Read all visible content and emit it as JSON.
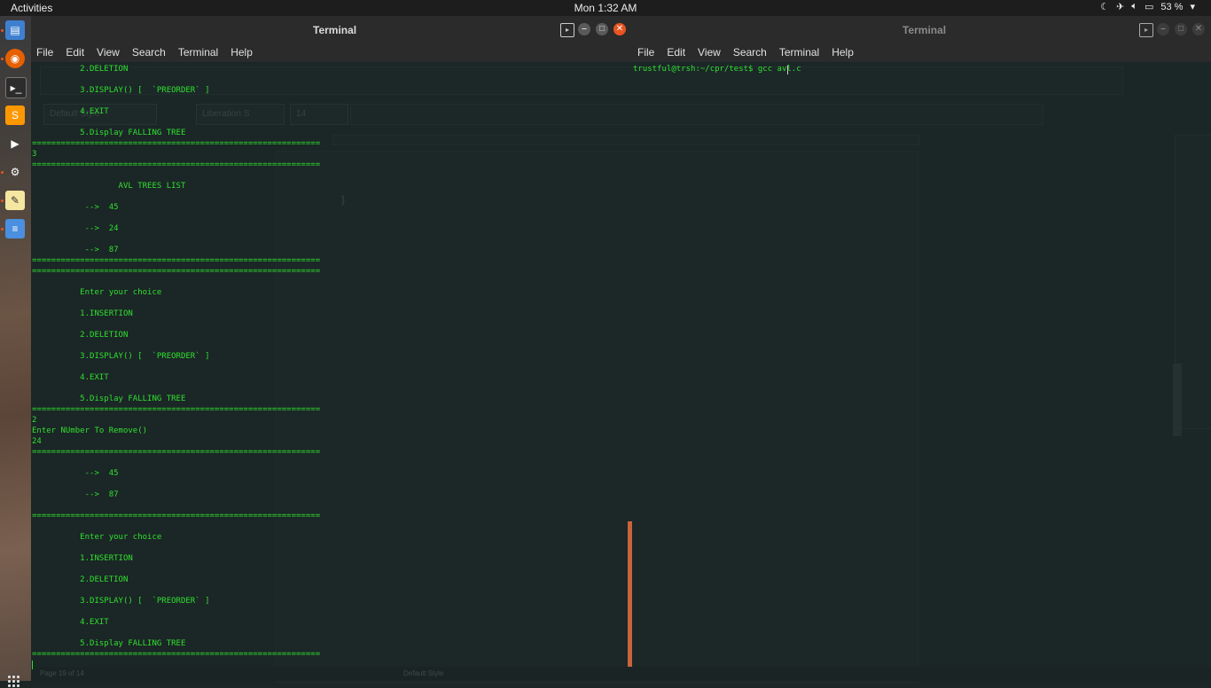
{
  "topbar": {
    "activities": "Activities",
    "clock": "Mon 1:32 AM",
    "battery": "53 %"
  },
  "dock": {
    "items": [
      "files-icon",
      "firefox-icon",
      "terminal-icon",
      "sublime-icon",
      "media-player-icon",
      "settings-icon",
      "text-editor-icon",
      "document-viewer-icon"
    ]
  },
  "left_window": {
    "title": "Terminal",
    "menu": [
      "File",
      "Edit",
      "View",
      "Search",
      "Terminal",
      "Help"
    ]
  },
  "right_window": {
    "title": "Terminal",
    "menu": [
      "File",
      "Edit",
      "View",
      "Search",
      "Terminal",
      "Help"
    ],
    "prompt_line": "trustful@trsh:~/cpr/test$ gcc avl.c"
  },
  "ghost_app": {
    "style_box": "Default Style",
    "font_box": "Liberation S",
    "size_box": "14",
    "status_left": "Page 19 of 14",
    "status_mid": "Default Style"
  },
  "terminal_lines": [
    "          2.DELETION",
    "          3.DISPLAY() [  `PREORDER` ]",
    "          4.EXIT",
    "          5.Display FALLING TREE",
    "==================================================",
    "3",
    "==================================================",
    "                  AVL TREES LIST",
    "           -->  45",
    "           -->  24",
    "           -->  87",
    "==================================================",
    "==================================================",
    "          Enter your choice",
    "          1.INSERTION",
    "          2.DELETION",
    "          3.DISPLAY() [  `PREORDER` ]",
    "          4.EXIT",
    "          5.Display FALLING TREE",
    "==================================================",
    "2",
    "Enter NUmber To Remove()",
    "24",
    "==================================================",
    "           -->  45",
    "           -->  87",
    "==================================================",
    "          Enter your choice",
    "          1.INSERTION",
    "          2.DELETION",
    "          3.DISPLAY() [  `PREORDER` ]",
    "          4.EXIT",
    "          5.Display FALLING TREE",
    "=================================================="
  ]
}
